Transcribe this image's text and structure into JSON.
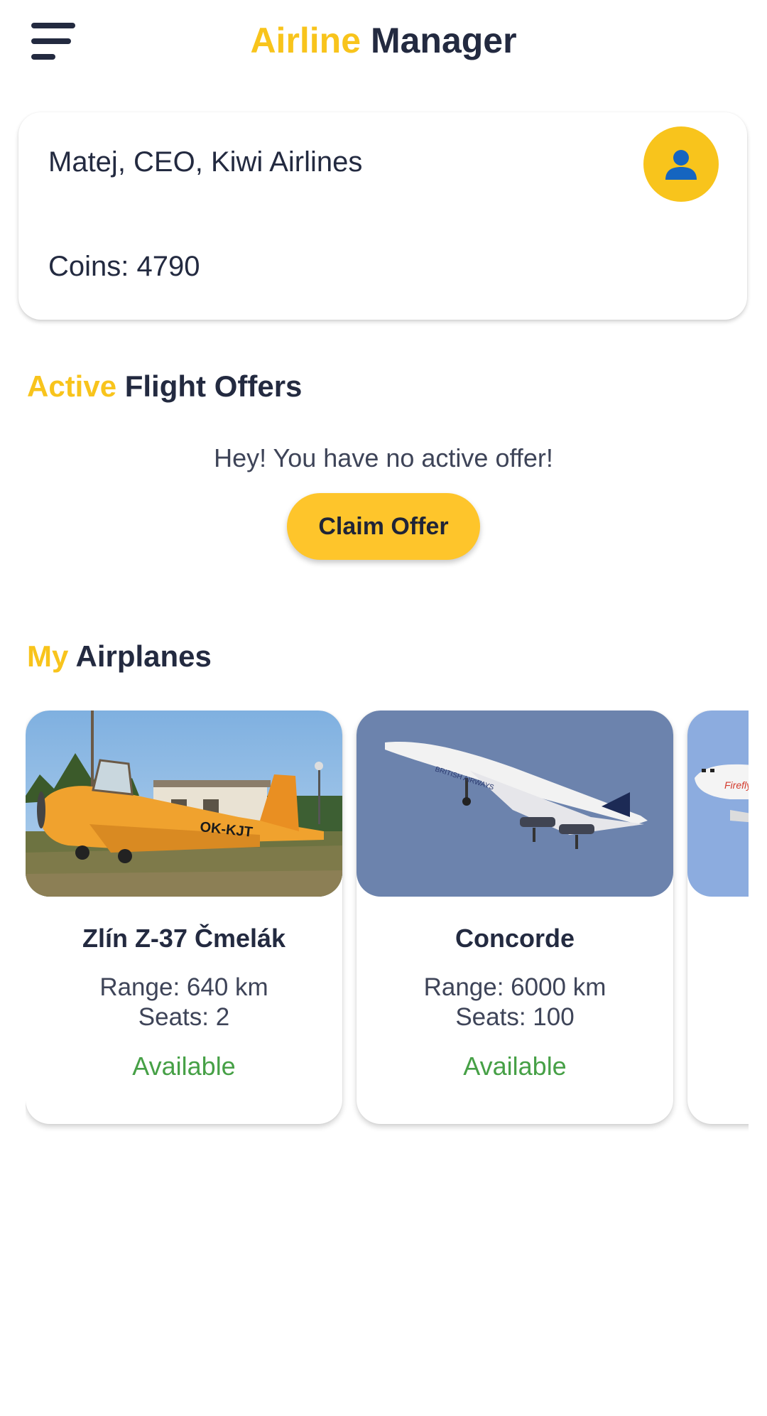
{
  "header": {
    "title_part1": "Airline",
    "title_part2": "Manager"
  },
  "profile": {
    "name_line": "Matej, CEO, Kiwi Airlines",
    "coins_line": "Coins: 4790"
  },
  "offers": {
    "title_highlight": "Active",
    "title_rest": "Flight Offers",
    "empty_message": "Hey! You have no active offer!",
    "claim_button": "Claim Offer"
  },
  "airplanes": {
    "title_highlight": "My",
    "title_rest": "Airplanes",
    "items": [
      {
        "name": "Zlín Z-37 Čmelák",
        "range": "Range: 640 km",
        "seats": "Seats: 2",
        "status": "Available",
        "registration": "OK-KJT"
      },
      {
        "name": "Concorde",
        "range": "Range: 6000 km",
        "seats": "Seats: 100",
        "status": "Available",
        "livery_text": "BRITISH AIRWAYS"
      },
      {
        "name": "",
        "range": "",
        "seats": "",
        "status": "",
        "livery_text": "Firefly"
      }
    ]
  },
  "colors": {
    "accent_yellow": "#f8c41c",
    "dark_text": "#232a40",
    "status_green": "#46a046",
    "avatar_icon": "#1565c0"
  }
}
